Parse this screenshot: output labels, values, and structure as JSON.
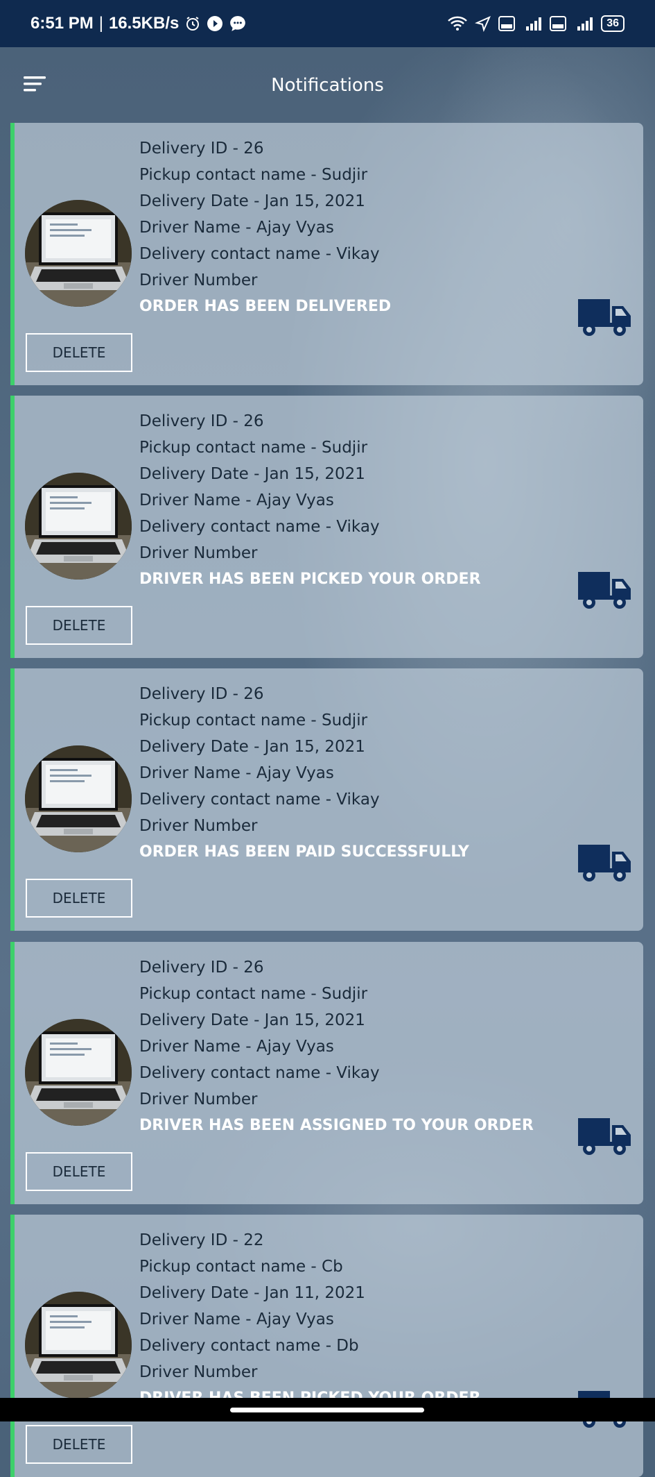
{
  "status_bar": {
    "time": "6:51 PM",
    "speed": "16.5KB/s",
    "battery": "36"
  },
  "header": {
    "title": "Notifications"
  },
  "colors": {
    "status_bar_bg": "#0f2a4f",
    "accent_green": "#3dd06a",
    "truck_icon": "#0f2e5c"
  },
  "notifications": [
    {
      "delivery_id": "Delivery ID - 26",
      "pickup_contact": "Pickup contact name - Sudjir",
      "delivery_date": "Delivery Date - Jan 15, 2021",
      "driver_name": "Driver Name - Ajay Vyas",
      "delivery_contact": "Delivery contact name - Vikay",
      "driver_number": "Driver Number",
      "status": "ORDER HAS BEEN DELIVERED",
      "delete_label": "DELETE"
    },
    {
      "delivery_id": "Delivery ID - 26",
      "pickup_contact": "Pickup contact name - Sudjir",
      "delivery_date": "Delivery Date - Jan 15, 2021",
      "driver_name": "Driver Name - Ajay Vyas",
      "delivery_contact": "Delivery contact name - Vikay",
      "driver_number": "Driver Number",
      "status": "DRIVER HAS BEEN PICKED YOUR ORDER",
      "delete_label": "DELETE"
    },
    {
      "delivery_id": "Delivery ID - 26",
      "pickup_contact": "Pickup contact name - Sudjir",
      "delivery_date": "Delivery Date - Jan 15, 2021",
      "driver_name": "Driver Name - Ajay Vyas",
      "delivery_contact": "Delivery contact name - Vikay",
      "driver_number": "Driver Number",
      "status": "ORDER HAS BEEN PAID SUCCESSFULLY",
      "delete_label": "DELETE"
    },
    {
      "delivery_id": "Delivery ID - 26",
      "pickup_contact": "Pickup contact name - Sudjir",
      "delivery_date": "Delivery Date - Jan 15, 2021",
      "driver_name": "Driver Name - Ajay Vyas",
      "delivery_contact": "Delivery contact name - Vikay",
      "driver_number": "Driver Number",
      "status": "DRIVER HAS BEEN ASSIGNED TO YOUR ORDER",
      "delete_label": "DELETE"
    },
    {
      "delivery_id": "Delivery ID - 22",
      "pickup_contact": "Pickup contact name - Cb",
      "delivery_date": "Delivery Date - Jan 11, 2021",
      "driver_name": "Driver Name - Ajay Vyas",
      "delivery_contact": "Delivery contact name - Db",
      "driver_number": "Driver Number",
      "status": "DRIVER HAS BEEN PICKED YOUR ORDER",
      "delete_label": "DELETE"
    }
  ]
}
